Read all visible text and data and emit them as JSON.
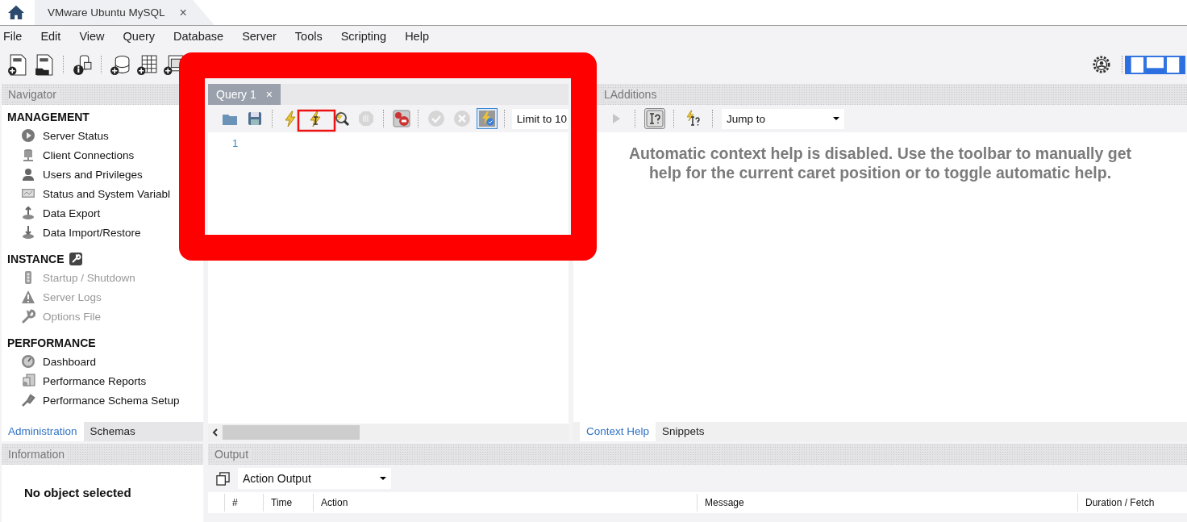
{
  "window_tabs": [
    {
      "label": "VMware Ubuntu MySQL",
      "close": "×",
      "selected": true
    }
  ],
  "menu": [
    "File",
    "Edit",
    "View",
    "Query",
    "Database",
    "Server",
    "Tools",
    "Scripting",
    "Help"
  ],
  "panel_toggles": [
    {
      "kind": "left",
      "on": true
    },
    {
      "kind": "bottom",
      "on": true
    },
    {
      "kind": "right",
      "on": true
    }
  ],
  "navigator": {
    "title": "Navigator",
    "sections": [
      {
        "title": "MANAGEMENT",
        "items": [
          {
            "label": "Server Status",
            "disabled": false
          },
          {
            "label": "Client Connections",
            "disabled": false
          },
          {
            "label": "Users and Privileges",
            "disabled": false
          },
          {
            "label": "Status and System Variabl",
            "disabled": false
          },
          {
            "label": "Data Export",
            "disabled": false
          },
          {
            "label": "Data Import/Restore",
            "disabled": false
          }
        ]
      },
      {
        "title": "INSTANCE",
        "items": [
          {
            "label": "Startup / Shutdown",
            "disabled": true
          },
          {
            "label": "Server Logs",
            "disabled": true
          },
          {
            "label": "Options File",
            "disabled": true
          }
        ]
      },
      {
        "title": "PERFORMANCE",
        "items": [
          {
            "label": "Dashboard",
            "disabled": false
          },
          {
            "label": "Performance Reports",
            "disabled": false
          },
          {
            "label": "Performance Schema Setup",
            "disabled": false
          }
        ]
      }
    ]
  },
  "navigator_tabs": [
    {
      "label": "Administration",
      "selected": true
    },
    {
      "label": "Schemas",
      "selected": false
    }
  ],
  "information": {
    "title": "Information",
    "message": "No object selected"
  },
  "editor": {
    "tab": {
      "label": "Query 1",
      "close": "×"
    },
    "toolbar": [
      {
        "kind": "open",
        "disabled": false,
        "on": false
      },
      {
        "kind": "save",
        "disabled": false,
        "on": false
      },
      {
        "kind": "execute",
        "disabled": false,
        "on": false
      },
      {
        "kind": "execute_current",
        "disabled": false,
        "on": false
      },
      {
        "kind": "explain",
        "disabled": false,
        "on": false
      },
      {
        "kind": "stop",
        "disabled": true,
        "on": false
      },
      {
        "kind": "stop_on_error",
        "disabled": false,
        "on": false
      },
      {
        "kind": "commit",
        "disabled": true,
        "on": false
      },
      {
        "kind": "rollback",
        "disabled": true,
        "on": false
      },
      {
        "kind": "autocommit",
        "disabled": false,
        "on": true
      }
    ],
    "limit": "Limit to 10",
    "line_numbers": [
      "1"
    ]
  },
  "sql_additions": {
    "title": "LAdditions",
    "toolbar": [
      {
        "kind": "play",
        "disabled": true,
        "on": false
      },
      {
        "kind": "manual_help",
        "disabled": false,
        "on": true
      },
      {
        "kind": "auto_help",
        "disabled": false,
        "on": false
      }
    ],
    "jump_to": "Jump to",
    "help_text": "Automatic context help is disabled. Use the toolbar to manually get help for the current caret position or to toggle automatic help.",
    "tabs": [
      {
        "label": "Context Help",
        "selected": true
      },
      {
        "label": "Snippets",
        "selected": false
      }
    ]
  },
  "output": {
    "title": "Output",
    "selector": "Action Output",
    "columns": [
      "#",
      "Time",
      "Action",
      "Message",
      "Duration / Fetch"
    ]
  }
}
